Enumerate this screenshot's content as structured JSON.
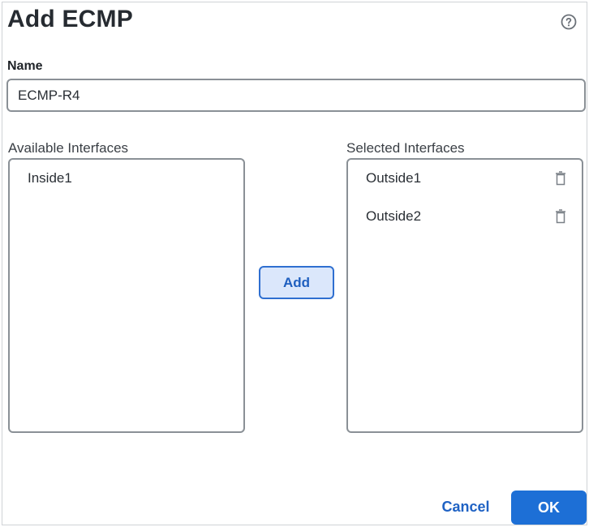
{
  "dialog": {
    "title": "Add ECMP",
    "help_icon": "help-circle-icon"
  },
  "name_field": {
    "label": "Name",
    "value": "ECMP-R4"
  },
  "available": {
    "label": "Available Interfaces",
    "items": [
      "Inside1"
    ]
  },
  "selected": {
    "label": "Selected Interfaces",
    "items": [
      "Outside1",
      "Outside2"
    ],
    "remove_icon": "trash-icon"
  },
  "buttons": {
    "add": "Add",
    "cancel": "Cancel",
    "ok": "OK"
  },
  "colors": {
    "accent": "#1d6fd6",
    "add_bg": "#dbe7fb",
    "border": "#8a9096"
  }
}
